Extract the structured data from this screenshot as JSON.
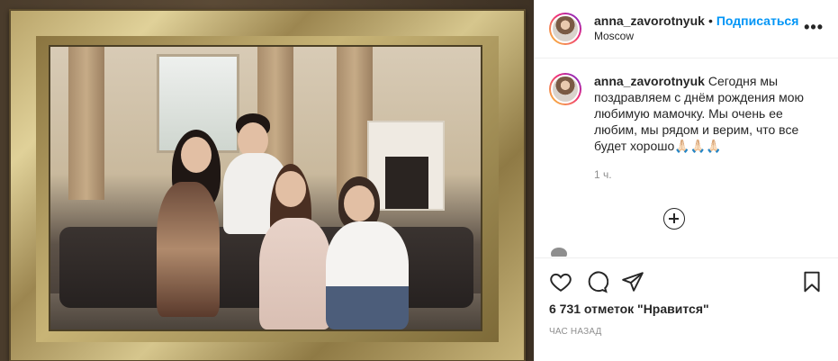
{
  "header": {
    "username": "anna_zavorotnyuk",
    "separator": "•",
    "follow_label": "Подписаться",
    "location": "Moscow",
    "more_label": "•••"
  },
  "caption": {
    "username": "anna_zavorotnyuk",
    "text": "Сегодня мы поздравляем с днём рождения мою любимую мамочку. Мы очень ее любим, мы рядом и верим, что все будет хорошо🙏🏻🙏🏻🙏🏻",
    "time": "1 ч."
  },
  "actions": {
    "likes_text": "6 731 отметок \"Нравится\"",
    "ago_text": "ЧАС НАЗАД"
  },
  "icons": {
    "more": "more-options-icon",
    "load_more": "plus-circle-icon",
    "like": "heart-icon",
    "comment": "comment-icon",
    "share": "paper-plane-icon",
    "save": "bookmark-icon"
  },
  "colors": {
    "follow": "#0095f6",
    "text": "#262626",
    "secondary": "#8e8e8e",
    "divider": "#efefef"
  }
}
